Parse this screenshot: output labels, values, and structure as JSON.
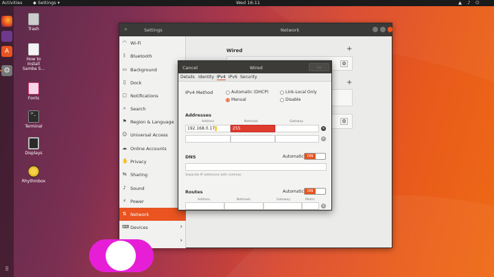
{
  "topbar": {
    "activities": "Activities",
    "app_menu": "Settings",
    "clock": "Wed 16:11"
  },
  "desktop_icons": [
    {
      "label": "Trash"
    },
    {
      "label": "How to Install Samba S..."
    },
    {
      "label": "Fonts"
    },
    {
      "label": "Terminal"
    },
    {
      "label": "Displays"
    },
    {
      "label": "Rhythmbox"
    }
  ],
  "settings": {
    "title": "Settings",
    "panel_title": "Network",
    "sidebar": [
      {
        "label": "Wi-Fi",
        "icon": "wifi-icon"
      },
      {
        "label": "Bluetooth",
        "icon": "bluetooth-icon"
      },
      {
        "label": "Background",
        "icon": "background-icon"
      },
      {
        "label": "Dock",
        "icon": "dock-icon"
      },
      {
        "label": "Notifications",
        "icon": "bell-icon"
      },
      {
        "label": "Search",
        "icon": "search-icon"
      },
      {
        "label": "Region & Language",
        "icon": "region-icon"
      },
      {
        "label": "Universal Access",
        "icon": "accessibility-icon"
      },
      {
        "label": "Online Accounts",
        "icon": "accounts-icon"
      },
      {
        "label": "Privacy",
        "icon": "privacy-icon"
      },
      {
        "label": "Sharing",
        "icon": "sharing-icon"
      },
      {
        "label": "Sound",
        "icon": "sound-icon"
      },
      {
        "label": "Power",
        "icon": "power-icon"
      },
      {
        "label": "Network",
        "icon": "network-icon"
      },
      {
        "label": "Devices",
        "icon": "devices-icon"
      }
    ],
    "wired_heading": "Wired"
  },
  "dialog": {
    "cancel": "Cancel",
    "title": "Wired",
    "tabs": [
      "Details",
      "Identity",
      "IPv4",
      "IPv6",
      "Security"
    ],
    "ipv4_method_label": "IPv4 Method",
    "methods": {
      "auto": "Automatic (DHCP)",
      "link_local": "Link-Local Only",
      "manual": "Manual",
      "disable": "Disable"
    },
    "addresses_label": "Addresses",
    "columns": {
      "address": "Address",
      "netmask": "Netmask",
      "gateway": "Gateway"
    },
    "address_value": "192.168.0.17",
    "netmask_value": "255",
    "dns_label": "DNS",
    "automatic_label": "Automatic",
    "toggle_on": "ON",
    "dns_hint": "Separate IP addresses with commas",
    "routes_label": "Routes",
    "routes_columns": {
      "address": "Address",
      "netmask": "Netmask",
      "gateway": "Gateway",
      "metric": "Metric"
    }
  },
  "colors": {
    "accent": "#e95420",
    "error": "#df3b2e",
    "blob": "#e61fd7"
  }
}
